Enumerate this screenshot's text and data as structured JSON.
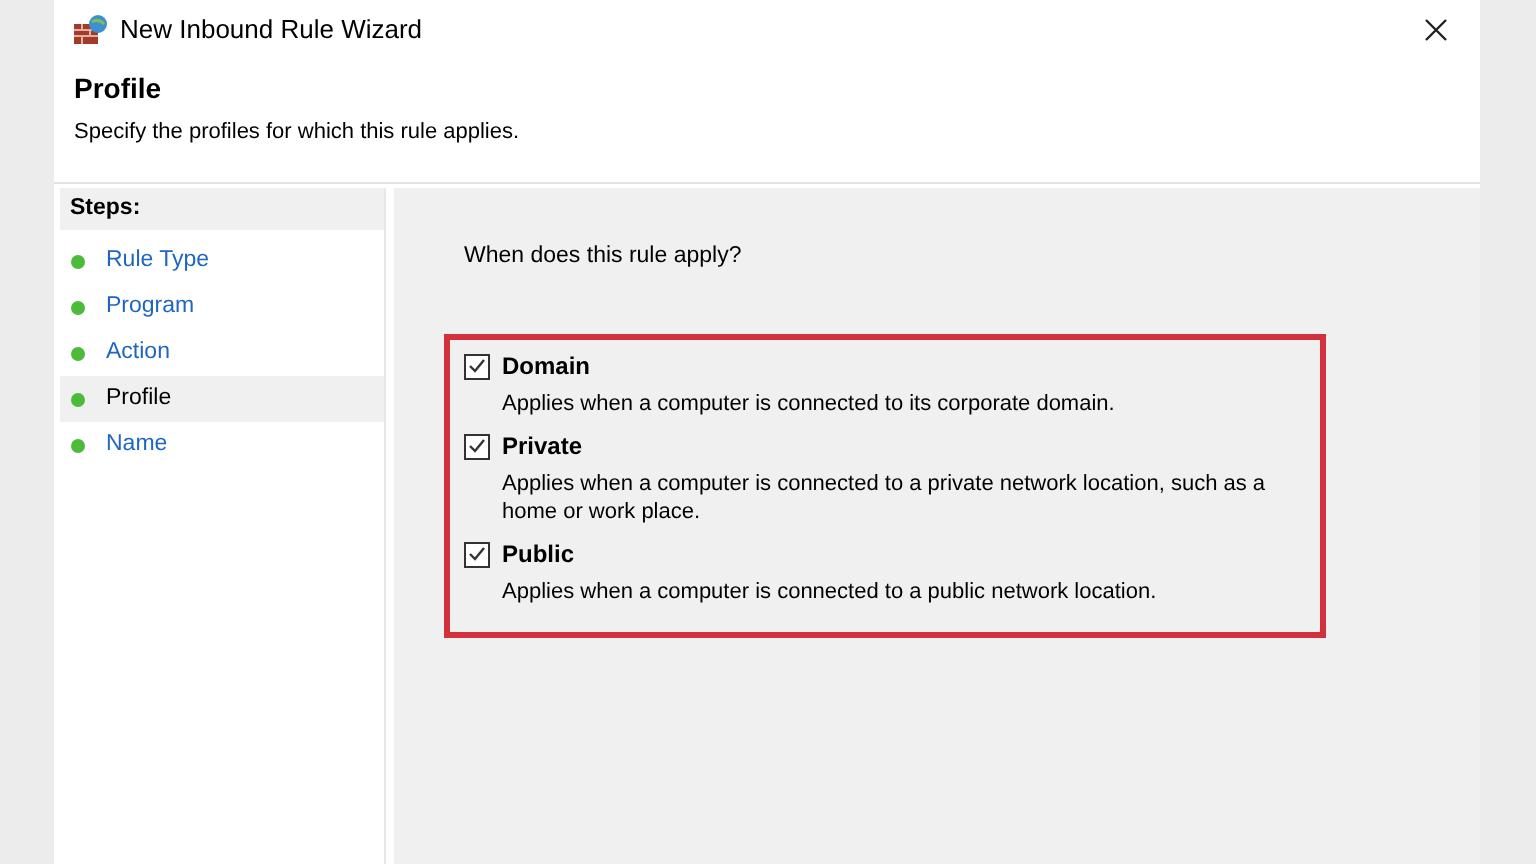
{
  "window": {
    "title": "New Inbound Rule Wizard"
  },
  "header": {
    "title": "Profile",
    "subtitle": "Specify the profiles for which this rule applies."
  },
  "steps": {
    "heading": "Steps:",
    "items": [
      {
        "label": "Rule Type",
        "selected": false
      },
      {
        "label": "Program",
        "selected": false
      },
      {
        "label": "Action",
        "selected": false
      },
      {
        "label": "Profile",
        "selected": true
      },
      {
        "label": "Name",
        "selected": false
      }
    ]
  },
  "question": "When does this rule apply?",
  "options": [
    {
      "label": "Domain",
      "checked": true,
      "description": "Applies when a computer is connected to its corporate domain."
    },
    {
      "label": "Private",
      "checked": true,
      "description": "Applies when a computer is connected to a private network location, such as a home or work place."
    },
    {
      "label": "Public",
      "checked": true,
      "description": "Applies when a computer is connected to a public network location."
    }
  ]
}
